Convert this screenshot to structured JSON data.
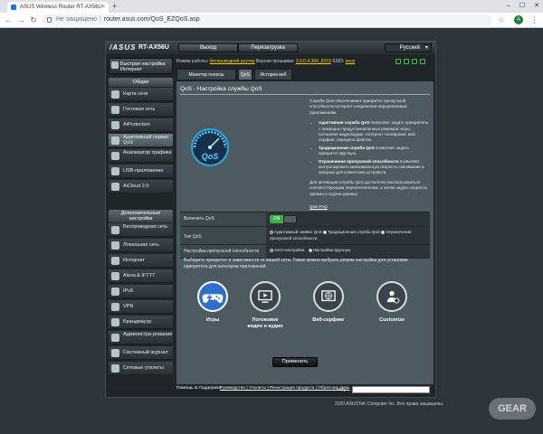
{
  "browser": {
    "tab_title": "ASUS Wireless Router RT-AX56U",
    "tab_close": "×",
    "new_tab": "+",
    "url_security": "Не защищено",
    "url": "router.asus.com/QoS_EZQoS.asp",
    "profile_initial": "A",
    "window_min": "–",
    "window_max": "☐",
    "window_close": "✕"
  },
  "router": {
    "logo": "/ASUS",
    "model": "RT-AX56U",
    "logout": "Выход",
    "reboot": "Перезагрузка",
    "language": "Русский",
    "info": {
      "mode_label": "Режим работы:",
      "mode_value": "беспроводной роутер",
      "fw_label": "Версия прошивки:",
      "fw_value": "3.0.0.4.384_8253",
      "ssid_label": "SSID:",
      "ssid_value": "asus"
    }
  },
  "sidebar": {
    "quick_setup": "Быстрая настройка Интернет",
    "general_header": "Общие",
    "general_items": [
      {
        "label": "Карта сети",
        "icon": "network-map-icon"
      },
      {
        "label": "Гостевая сеть",
        "icon": "guest-network-icon"
      },
      {
        "label": "AiProtection",
        "icon": "shield-icon"
      },
      {
        "label": "Адаптивный сервис QoS",
        "icon": "qos-icon"
      },
      {
        "label": "Анализатор трафика",
        "icon": "traffic-analyzer-icon"
      },
      {
        "label": "USB-приложение",
        "icon": "usb-icon"
      },
      {
        "label": "AiCloud 2.0",
        "icon": "cloud-icon"
      }
    ],
    "advanced_header": "Дополнительные настройки",
    "advanced_items": [
      {
        "label": "Беспроводная сеть",
        "icon": "wireless-icon"
      },
      {
        "label": "Локальная сеть",
        "icon": "lan-icon"
      },
      {
        "label": "Интернет",
        "icon": "globe-icon"
      },
      {
        "label": "Alexa & IFTTT",
        "icon": "alexa-icon"
      },
      {
        "label": "IPv6",
        "icon": "ipv6-icon"
      },
      {
        "label": "VPN",
        "icon": "vpn-icon"
      },
      {
        "label": "Брандмауэр",
        "icon": "firewall-icon"
      },
      {
        "label": "Администри-рование",
        "icon": "admin-icon"
      },
      {
        "label": "Системный журнал",
        "icon": "log-icon"
      },
      {
        "label": "Сетевые утилиты",
        "icon": "tools-icon"
      }
    ]
  },
  "tabs": [
    "Монитор полосы пропускания",
    "QoS",
    "История веб"
  ],
  "panel": {
    "title": "QoS - Настройка службы QoS",
    "intro": "Служба QoS обеспечивает приоритет пропускной способности интернет-соединения определенным приложениям.",
    "bullet1_bold": "Адаптивная служба QoS",
    "bullet1_text": " позволяет задать приоритеты с помощью предустановленных режимов: игры, потоковое видео/аудио, интернет-телефония, веб-серфинг, передача файлов.",
    "bullet2_bold": "Традиционная служба QoS",
    "bullet2_text": " позволяет задать приоритет вручную.",
    "bullet3_bold": "Ограничение пропускной способности",
    "bullet3_text": " позволяет контролировать максимальную скорость скачивания и загрузки для клиентских устройств.",
    "note": "Для активации службы QoS достаточно воспользоваться соответствующим переключателем, а затем задать скорость приема и отдачи данных.",
    "faq": "QoS FAQ",
    "gauge_text": "QoS"
  },
  "settings": {
    "enable_label": "Включить QoS",
    "enable_on": "ON",
    "type_label": "Тип QoS",
    "type_options": [
      "Адаптивный сервис QoS",
      "Традиционная служба QoS",
      "Ограничение пропускной способности"
    ],
    "bw_label": "Настройка пропускной способности",
    "bw_options": [
      "Авто-настройка",
      "Настройка вручную"
    ]
  },
  "priority": {
    "prompt": "Выберите приоритет в зависимости от вашей сети. Также можно выбрать режим настройки для установки приоритета для категории приложений.",
    "modes": [
      {
        "label": "Игры",
        "icon": "gamepad-icon"
      },
      {
        "label": "Потоковое видео и аудио",
        "icon": "media-icon"
      },
      {
        "label": "Веб-серфинг",
        "icon": "globe-icon"
      },
      {
        "label": "Customize",
        "icon": "customize-icon"
      }
    ],
    "apply": "Применить"
  },
  "footer": {
    "help": "Помощь & Поддержка",
    "links": "Руководство | Утилиты | Регистрация продукта | Обратная связь",
    "faq": "FAQ",
    "copyright": "2020 ASUSTeK Computer Inc. Все права защищены."
  },
  "colors": {
    "accent": "#2f6fcc",
    "on": "#3ab043",
    "panel": "#4d5a62",
    "frame": "#1f2528"
  }
}
